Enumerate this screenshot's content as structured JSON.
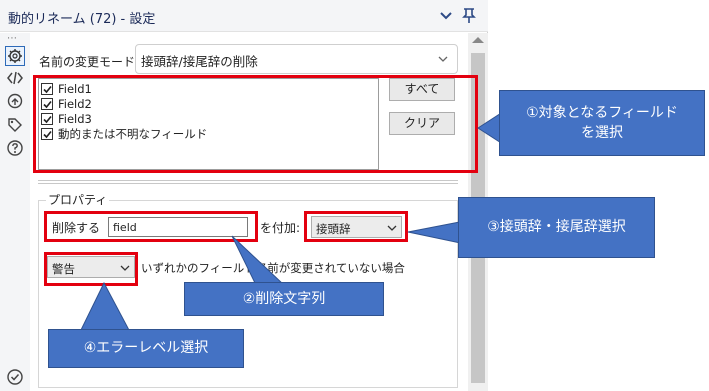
{
  "panel": {
    "title": "動的リネーム (72) - 設定",
    "collapse_icon": "chevron-down-icon",
    "pin_icon": "pin-icon"
  },
  "sidebar": {
    "icons": [
      "gear-icon",
      "code-icon",
      "circular-arrow-icon",
      "tag-icon",
      "help-icon",
      "check-circle-icon"
    ],
    "dots": "⋯"
  },
  "form": {
    "mode_label": "名前の変更モード:",
    "mode_value": "接頭辞/接尾辞の削除",
    "fields": [
      {
        "label": "Field1",
        "checked": true
      },
      {
        "label": "Field2",
        "checked": true
      },
      {
        "label": "Field3",
        "checked": true
      },
      {
        "label": "動的または不明なフィールド",
        "checked": true
      }
    ],
    "select_all_label": "すべて",
    "clear_label": "クリア",
    "properties_title": "プロパティ",
    "delete_label": "削除する",
    "delete_value": "field",
    "attach_label": "を付加:",
    "attach_value": "接頭辞",
    "level_value": "警告",
    "warning_text": "いずれかのフィールド名前が変更されていない場合"
  },
  "annotations": {
    "callout1_line1": "①対象となるフィールド",
    "callout1_line2": "を選択",
    "callout2": "②削除文字列",
    "callout3": "③接頭辞・接尾辞選択",
    "callout4": "④エラーレベル選択",
    "highlight_color": "#e3000f",
    "callout_color": "#4472c4"
  }
}
